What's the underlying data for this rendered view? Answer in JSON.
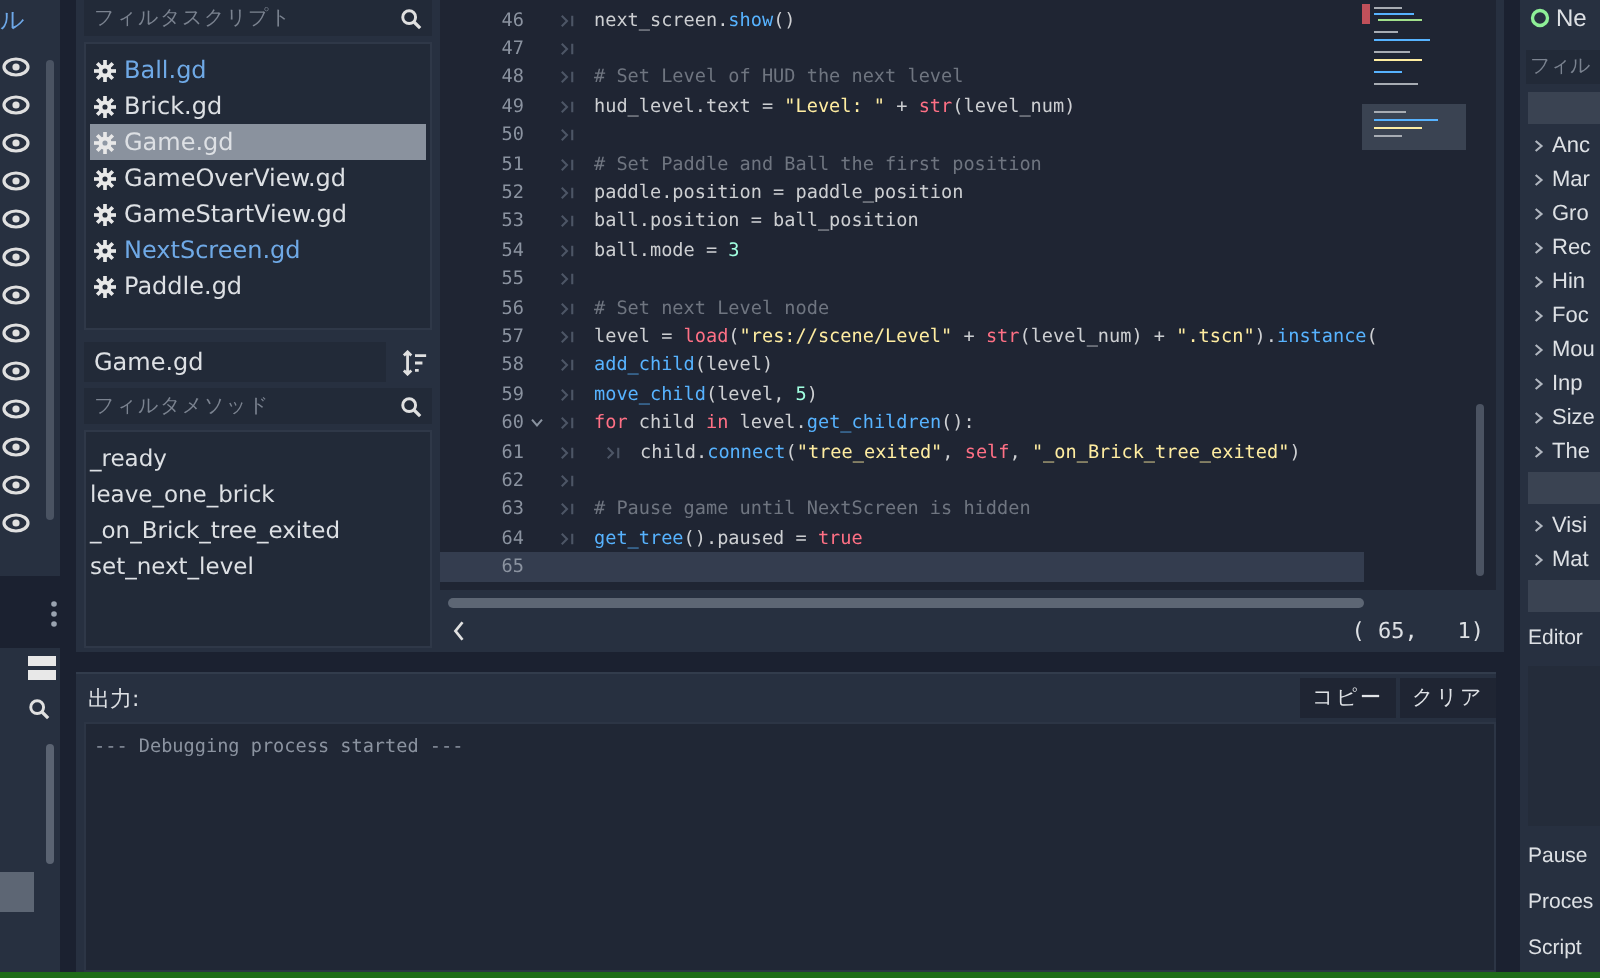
{
  "scene_dock": {
    "label": "ル",
    "rows": [
      {
        "visible": true
      },
      {
        "visible": true
      },
      {
        "visible": true
      },
      {
        "visible": true
      },
      {
        "visible": true
      },
      {
        "visible": true
      },
      {
        "visible": true
      },
      {
        "visible": true
      },
      {
        "visible": true
      },
      {
        "visible": true
      },
      {
        "visible": true
      },
      {
        "visible": true
      },
      {
        "visible": true
      }
    ]
  },
  "scripts": {
    "filter_placeholder": "フィルタスクリプト",
    "items": [
      {
        "label": "Ball.gd",
        "highlighted": true,
        "selected": false
      },
      {
        "label": "Brick.gd",
        "highlighted": false,
        "selected": false
      },
      {
        "label": "Game.gd",
        "highlighted": false,
        "selected": true
      },
      {
        "label": "GameOverView.gd",
        "highlighted": false,
        "selected": false
      },
      {
        "label": "GameStartView.gd",
        "highlighted": false,
        "selected": false
      },
      {
        "label": "NextScreen.gd",
        "highlighted": true,
        "selected": false
      },
      {
        "label": "Paddle.gd",
        "highlighted": false,
        "selected": false
      }
    ],
    "current_script": "Game.gd",
    "method_filter_placeholder": "フィルタメソッド",
    "methods": [
      {
        "label": "_ready"
      },
      {
        "label": "leave_one_brick"
      },
      {
        "label": "_on_Brick_tree_exited"
      },
      {
        "label": "set_next_level"
      }
    ]
  },
  "editor": {
    "lines": [
      {
        "number": "46",
        "current": false,
        "fold": false,
        "tokens": [
          {
            "kind": "tab"
          },
          {
            "kind": "plain",
            "text": "next_screen."
          },
          {
            "kind": "func",
            "text": "show"
          },
          {
            "kind": "plain",
            "text": "()"
          }
        ]
      },
      {
        "number": "47",
        "current": false,
        "fold": false,
        "tokens": [
          {
            "kind": "tab"
          }
        ]
      },
      {
        "number": "48",
        "current": false,
        "fold": false,
        "tokens": [
          {
            "kind": "tab"
          },
          {
            "kind": "comment",
            "text": "# Set Level of HUD the next level"
          }
        ]
      },
      {
        "number": "49",
        "current": false,
        "fold": false,
        "tokens": [
          {
            "kind": "tab"
          },
          {
            "kind": "plain",
            "text": "hud_level.text = "
          },
          {
            "kind": "string",
            "text": "\"Level: \""
          },
          {
            "kind": "plain",
            "text": " + "
          },
          {
            "kind": "keyword",
            "text": "str"
          },
          {
            "kind": "plain",
            "text": "(level_num)"
          }
        ]
      },
      {
        "number": "50",
        "current": false,
        "fold": false,
        "tokens": [
          {
            "kind": "tab"
          }
        ]
      },
      {
        "number": "51",
        "current": false,
        "fold": false,
        "tokens": [
          {
            "kind": "tab"
          },
          {
            "kind": "comment",
            "text": "# Set Paddle and Ball the first position"
          }
        ]
      },
      {
        "number": "52",
        "current": false,
        "fold": false,
        "tokens": [
          {
            "kind": "tab"
          },
          {
            "kind": "plain",
            "text": "paddle.position = paddle_position"
          }
        ]
      },
      {
        "number": "53",
        "current": false,
        "fold": false,
        "tokens": [
          {
            "kind": "tab"
          },
          {
            "kind": "plain",
            "text": "ball.position = ball_position"
          }
        ]
      },
      {
        "number": "54",
        "current": false,
        "fold": false,
        "tokens": [
          {
            "kind": "tab"
          },
          {
            "kind": "plain",
            "text": "ball.mode = "
          },
          {
            "kind": "number",
            "text": "3"
          }
        ]
      },
      {
        "number": "55",
        "current": false,
        "fold": false,
        "tokens": [
          {
            "kind": "tab"
          }
        ]
      },
      {
        "number": "56",
        "current": false,
        "fold": false,
        "tokens": [
          {
            "kind": "tab"
          },
          {
            "kind": "comment",
            "text": "# Set next Level node"
          }
        ]
      },
      {
        "number": "57",
        "current": false,
        "fold": false,
        "tokens": [
          {
            "kind": "tab"
          },
          {
            "kind": "plain",
            "text": "level = "
          },
          {
            "kind": "keyword",
            "text": "load"
          },
          {
            "kind": "plain",
            "text": "("
          },
          {
            "kind": "string",
            "text": "\"res://scene/Level\""
          },
          {
            "kind": "plain",
            "text": " + "
          },
          {
            "kind": "keyword",
            "text": "str"
          },
          {
            "kind": "plain",
            "text": "(level_num) + "
          },
          {
            "kind": "string",
            "text": "\".tscn\""
          },
          {
            "kind": "plain",
            "text": ")."
          },
          {
            "kind": "func",
            "text": "instance"
          },
          {
            "kind": "plain",
            "text": "("
          }
        ]
      },
      {
        "number": "58",
        "current": false,
        "fold": false,
        "tokens": [
          {
            "kind": "tab"
          },
          {
            "kind": "func",
            "text": "add_child"
          },
          {
            "kind": "plain",
            "text": "(level)"
          }
        ]
      },
      {
        "number": "59",
        "current": false,
        "fold": false,
        "tokens": [
          {
            "kind": "tab"
          },
          {
            "kind": "func",
            "text": "move_child"
          },
          {
            "kind": "plain",
            "text": "(level, "
          },
          {
            "kind": "number",
            "text": "5"
          },
          {
            "kind": "plain",
            "text": ")"
          }
        ]
      },
      {
        "number": "60",
        "current": false,
        "fold": true,
        "tokens": [
          {
            "kind": "tab"
          },
          {
            "kind": "keyword",
            "text": "for"
          },
          {
            "kind": "plain",
            "text": " child "
          },
          {
            "kind": "keyword",
            "text": "in"
          },
          {
            "kind": "plain",
            "text": " level."
          },
          {
            "kind": "func",
            "text": "get_children"
          },
          {
            "kind": "plain",
            "text": "():"
          }
        ]
      },
      {
        "number": "61",
        "current": false,
        "fold": false,
        "tokens": [
          {
            "kind": "tab"
          },
          {
            "kind": "tab"
          },
          {
            "kind": "plain",
            "text": "child."
          },
          {
            "kind": "func",
            "text": "connect"
          },
          {
            "kind": "plain",
            "text": "("
          },
          {
            "kind": "string",
            "text": "\"tree_exited\""
          },
          {
            "kind": "plain",
            "text": ", "
          },
          {
            "kind": "keyword",
            "text": "self"
          },
          {
            "kind": "plain",
            "text": ", "
          },
          {
            "kind": "string",
            "text": "\"_on_Brick_tree_exited\""
          },
          {
            "kind": "plain",
            "text": ")"
          }
        ]
      },
      {
        "number": "62",
        "current": false,
        "fold": false,
        "tokens": [
          {
            "kind": "tab"
          }
        ]
      },
      {
        "number": "63",
        "current": false,
        "fold": false,
        "tokens": [
          {
            "kind": "tab"
          },
          {
            "kind": "comment",
            "text": "# Pause game until NextScreen is hidden"
          }
        ]
      },
      {
        "number": "64",
        "current": false,
        "fold": false,
        "tokens": [
          {
            "kind": "tab"
          },
          {
            "kind": "func",
            "text": "get_tree"
          },
          {
            "kind": "plain",
            "text": "().paused = "
          },
          {
            "kind": "keyword",
            "text": "true"
          }
        ]
      },
      {
        "number": "65",
        "current": true,
        "fold": false
      }
    ],
    "cursor_position": "( 65,   1)"
  },
  "output": {
    "title": "出力:",
    "buttons": [
      {
        "label": "コピー"
      },
      {
        "label": "クリア"
      }
    ],
    "log": "--- Debugging process started ---"
  },
  "inspector": {
    "node_tab": "Ne",
    "filter_placeholder": "フィル",
    "items": [
      {
        "kind": "header"
      },
      {
        "kind": "group",
        "label": "Anc"
      },
      {
        "kind": "group",
        "label": "Mar"
      },
      {
        "kind": "group",
        "label": "Gro"
      },
      {
        "kind": "group",
        "label": "Rec"
      },
      {
        "kind": "group",
        "label": "Hin"
      },
      {
        "kind": "group",
        "label": "Foc"
      },
      {
        "kind": "group",
        "label": "Mou"
      },
      {
        "kind": "group",
        "label": "Inp"
      },
      {
        "kind": "group",
        "label": "Size"
      },
      {
        "kind": "group",
        "label": "The"
      },
      {
        "kind": "header"
      },
      {
        "kind": "group",
        "label": "Visi"
      },
      {
        "kind": "group",
        "label": "Mat"
      },
      {
        "kind": "header"
      },
      {
        "kind": "property",
        "label": "Editor"
      },
      {
        "kind": "box"
      },
      {
        "kind": "property",
        "label": "Pause"
      },
      {
        "kind": "property",
        "label": "Proces"
      },
      {
        "kind": "property",
        "label": "Script"
      }
    ]
  }
}
